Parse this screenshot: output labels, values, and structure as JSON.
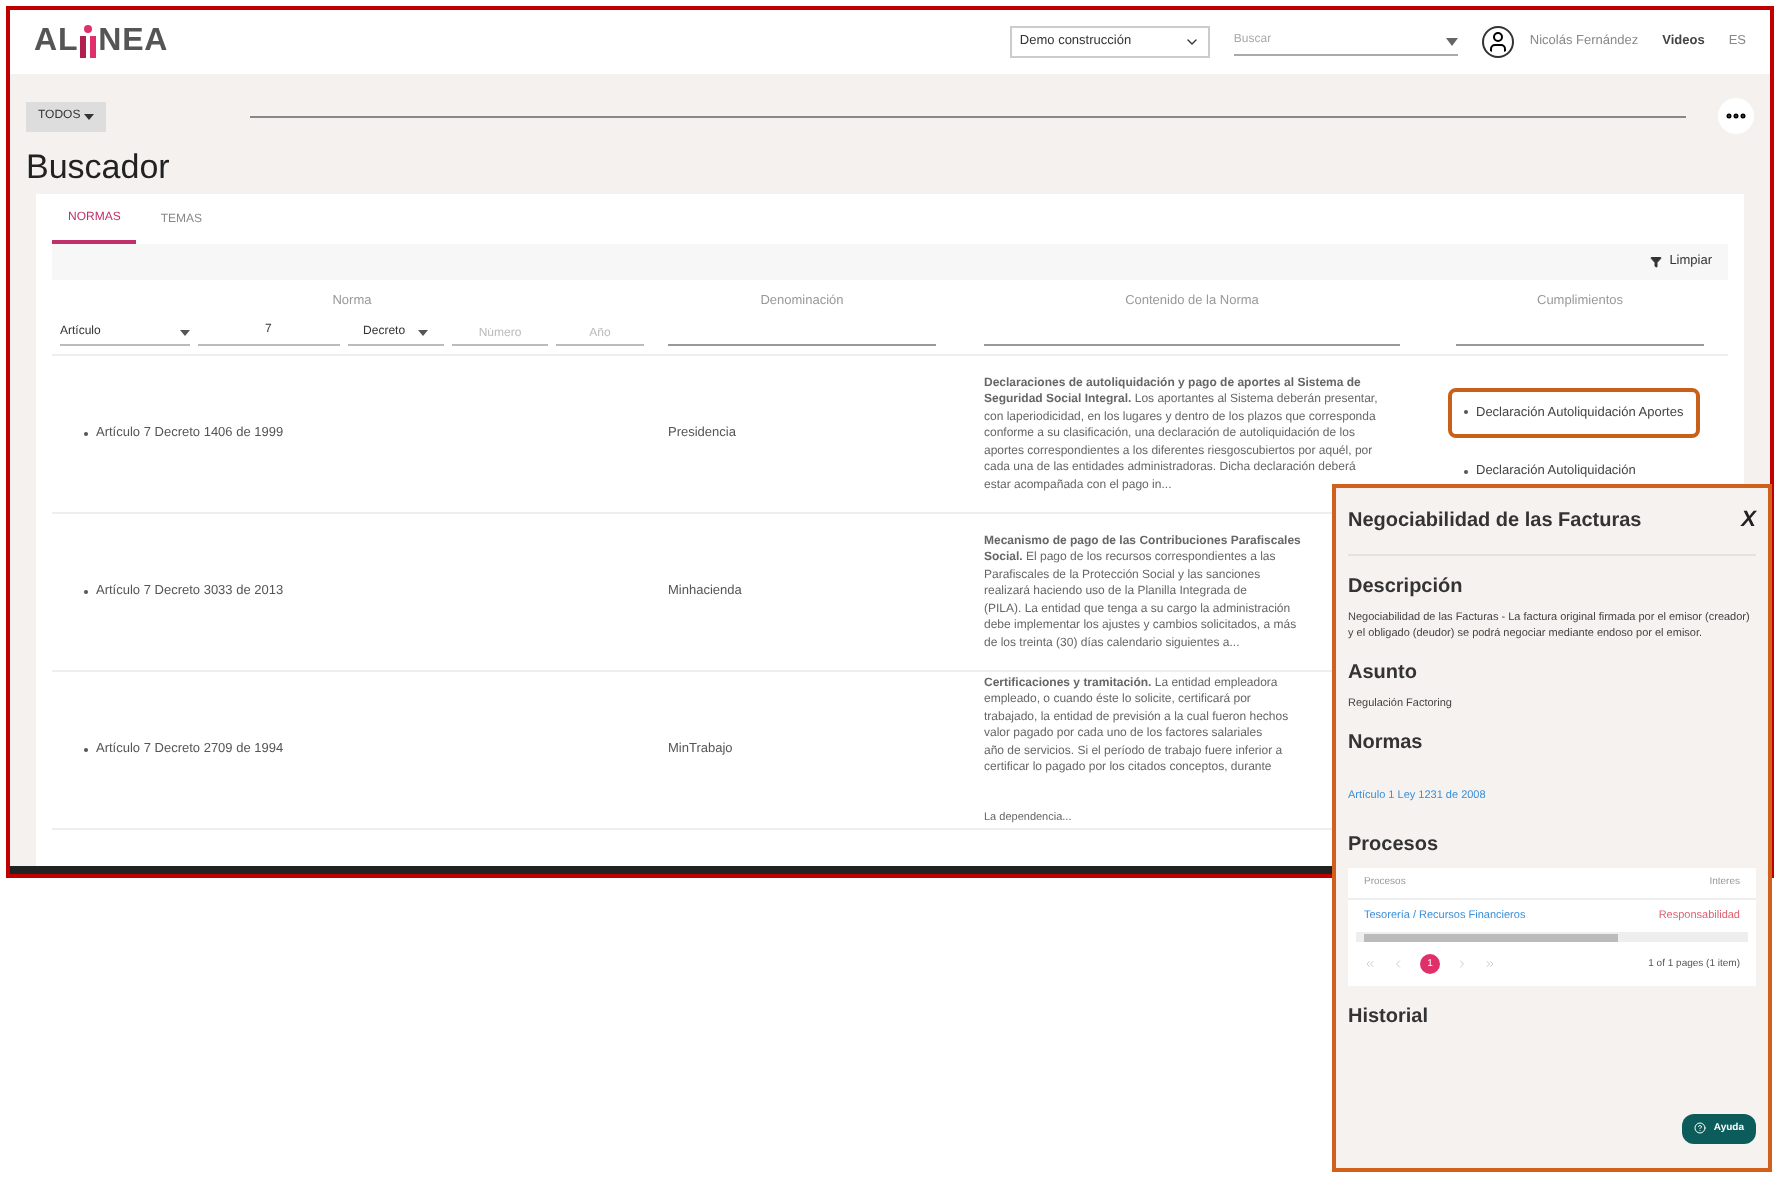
{
  "logo": {
    "left": "AL",
    "right": "NEA"
  },
  "header": {
    "company": "Demo construcción",
    "search": {
      "placeholder": "Buscar"
    },
    "user": "Nicolás Fernández",
    "links": [
      "Videos",
      "ES"
    ]
  },
  "toolbar": {
    "filter": "TODOS"
  },
  "page_title": "Buscador",
  "tabs": [
    {
      "label": "NORMAS",
      "selected": true
    },
    {
      "label": "TEMAS",
      "selected": false
    }
  ],
  "clear_button": "Limpiar",
  "table": {
    "columns": [
      "Norma",
      "Denominación",
      "Contenido de la Norma",
      "Cumplimientos"
    ],
    "filters": {
      "type": "Artículo",
      "number": "7",
      "norm_type": "Decreto",
      "norm_number": {
        "placeholder": "Número"
      },
      "year": {
        "placeholder": "Año"
      }
    },
    "rows": [
      {
        "norma": "Artículo 7 Decreto 1406 de 1999",
        "denominacion": "Presidencia",
        "content": [
          "**Declaraciones de autoliquidación y pago de aportes al Sistema de**",
          "**Seguridad Social Integral.** Los aportantes al Sistema deberán presentar,",
          "con laperiodicidad, en los lugares y dentro de los plazos que corresponda",
          "conforme a su clasificación, una declaración de autoliquidación de los",
          "aportes correspondientes a los diferentes riesgoscubiertos por aquél, por",
          "cada una de las entidades administradoras. Dicha declaración deberá",
          "estar acompañada con el pago in..."
        ],
        "cumplimientos": [
          {
            "label": "Declaración Autoliquidación Aportes",
            "highlighted": true
          },
          {
            "label": "Declaración Autoliquidación",
            "highlighted": false
          }
        ]
      },
      {
        "norma": "Artículo 7 Decreto 3033 de 2013",
        "denominacion": "Minhacienda",
        "content": [
          "**Mecanismo de pago de las Contribuciones Parafiscales**",
          "**Social.** El pago de los recursos correspondientes a las",
          "Parafiscales de la Protección Social y las sanciones",
          "realizará haciendo uso de la Planilla Integrada de",
          "(PILA). La entidad que tenga a su cargo la administración",
          "debe implementar los ajustes y cambios solicitados, a más",
          "de los treinta (30) días calendario siguientes a..."
        ],
        "cumplimientos": []
      },
      {
        "norma": "Artículo 7 Decreto 2709 de 1994",
        "denominacion": "MinTrabajo",
        "content": [
          "**Certificaciones y tramitación.** La entidad empleadora",
          "empleado, o cuando éste lo solicite, certificará por",
          "trabajado, la entidad de previsión a la cual fueron hechos",
          "valor pagado por cada uno de los factores salariales",
          "año de servicios. Si el período de trabajo fuere inferior a",
          "certificar lo pagado por los citados conceptos, durante"
        ],
        "more": "La dependencia...",
        "cumplimientos": []
      }
    ]
  },
  "popup": {
    "title": "Negociabilidad de las Facturas",
    "close": "X",
    "sections": [
      {
        "kind": "text",
        "heading": "Descripción",
        "text": "Negociabilidad de las Facturas - La factura original firmada por el emisor (creador) y el obligado (deudor) se podrá negociar mediante endoso por el emisor."
      },
      {
        "kind": "text",
        "heading": "Asunto",
        "text": "Regulación Factoring"
      },
      {
        "kind": "link",
        "heading": "Normas",
        "text": "Artículo 1 Ley 1231 de 2008"
      },
      {
        "kind": "table",
        "heading": "Procesos",
        "columns": [
          "Procesos",
          "Interes"
        ],
        "rows": [
          [
            "Tesorería / Recursos Financieros",
            "Responsabilidad"
          ]
        ],
        "pages": [
          {
            "label": "1",
            "selected": true
          }
        ],
        "summary": "1 of 1 pages (1 item)"
      },
      {
        "kind": "empty",
        "heading": "Historial"
      }
    ],
    "help": "Ayuda"
  }
}
